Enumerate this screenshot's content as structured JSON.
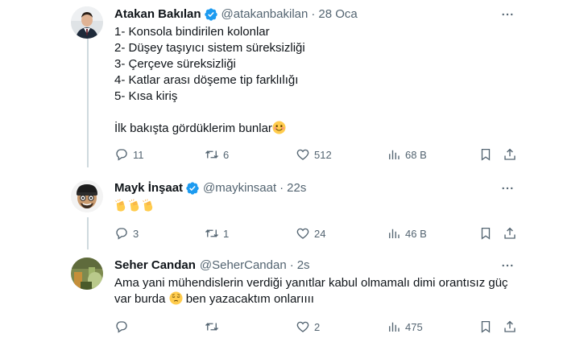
{
  "tweets": [
    {
      "name": "Atakan Bakılan",
      "handle": "@atakanbakilan",
      "time": "28 Oca",
      "lines": [
        "1- Konsola bindirilen kolonlar",
        "2- Düşey taşıyıcı sistem süreksizliği",
        "3- Çerçeve süreksizliği",
        "4- Katlar arası döşeme tip farklılığı",
        "5- Kısa kiriş",
        "",
        "İlk bakışta gördüklerim bunlar"
      ],
      "emoji": "smiling-face-emoji",
      "replies": "11",
      "retweets": "6",
      "likes": "512",
      "views": "68 B"
    },
    {
      "name": "Mayk İnşaat",
      "handle": "@maykinsaat",
      "time": "22s",
      "emoji": "clapping-hands-emoji",
      "emoji_count": 3,
      "replies": "3",
      "retweets": "1",
      "likes": "24",
      "views": "46 B"
    },
    {
      "name": "Seher Candan",
      "handle": "@SeherCandan",
      "time": "2s",
      "lines": [
        "Ama yani mühendislerin verdiği yanıtlar kabul olmamalı dimi orantısız güç",
        "var burda",
        "ben yazacaktım onlarıııı"
      ],
      "emoji": "pensive-face-emoji",
      "replies": "",
      "retweets": "",
      "likes": "2",
      "views": "475"
    }
  ],
  "colors": {
    "verified": "#1d9bf0",
    "text": "#0f1419",
    "secondary": "#536471",
    "thread_line": "#cfd9de"
  },
  "icons": [
    "reply-icon",
    "retweet-icon",
    "like-icon",
    "views-icon",
    "bookmark-icon",
    "share-icon",
    "more-icon",
    "verified-badge-icon"
  ]
}
